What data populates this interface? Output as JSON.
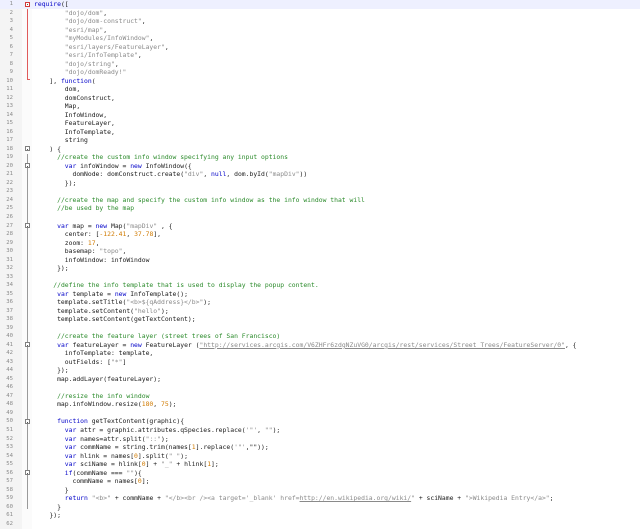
{
  "editor": {
    "language": "javascript",
    "current_line": 1,
    "lines": [
      {
        "n": "1",
        "fold": "box-red",
        "t": [
          [
            "k",
            "require"
          ],
          [
            "p",
            "(["
          ]
        ]
      },
      {
        "n": "2",
        "t": [
          [
            "p",
            "        "
          ],
          [
            "s",
            "\"dojo/dom\""
          ],
          [
            "p",
            ","
          ]
        ]
      },
      {
        "n": "3",
        "t": [
          [
            "p",
            "        "
          ],
          [
            "s",
            "\"dojo/dom-construct\""
          ],
          [
            "p",
            ","
          ]
        ]
      },
      {
        "n": "4",
        "t": [
          [
            "p",
            "        "
          ],
          [
            "s",
            "\"esri/map\""
          ],
          [
            "p",
            ","
          ]
        ]
      },
      {
        "n": "5",
        "t": [
          [
            "p",
            "        "
          ],
          [
            "s",
            "\"myModules/InfoWindow\""
          ],
          [
            "p",
            ","
          ]
        ]
      },
      {
        "n": "6",
        "t": [
          [
            "p",
            "        "
          ],
          [
            "s",
            "\"esri/layers/FeatureLayer\""
          ],
          [
            "p",
            ","
          ]
        ]
      },
      {
        "n": "7",
        "t": [
          [
            "p",
            "        "
          ],
          [
            "s",
            "\"esri/InfoTemplate\""
          ],
          [
            "p",
            ","
          ]
        ]
      },
      {
        "n": "8",
        "t": [
          [
            "p",
            "        "
          ],
          [
            "s",
            "\"dojo/string\""
          ],
          [
            "p",
            ","
          ]
        ]
      },
      {
        "n": "9",
        "t": [
          [
            "p",
            "        "
          ],
          [
            "s",
            "\"dojo/domReady!\""
          ]
        ]
      },
      {
        "n": "10",
        "fold": "end-red",
        "t": [
          [
            "p",
            "    ], "
          ],
          [
            "k",
            "function"
          ],
          [
            "p",
            "("
          ]
        ]
      },
      {
        "n": "11",
        "t": [
          [
            "p",
            "        dom,"
          ]
        ]
      },
      {
        "n": "12",
        "t": [
          [
            "p",
            "        domConstruct,"
          ]
        ]
      },
      {
        "n": "13",
        "t": [
          [
            "p",
            "        Map,"
          ]
        ]
      },
      {
        "n": "14",
        "t": [
          [
            "p",
            "        InfoWindow,"
          ]
        ]
      },
      {
        "n": "15",
        "t": [
          [
            "p",
            "        FeatureLayer,"
          ]
        ]
      },
      {
        "n": "16",
        "t": [
          [
            "p",
            "        InfoTemplate,"
          ]
        ]
      },
      {
        "n": "17",
        "t": [
          [
            "p",
            "        string"
          ]
        ]
      },
      {
        "n": "18",
        "fold": "box",
        "t": [
          [
            "p",
            "    ) {"
          ]
        ]
      },
      {
        "n": "19",
        "t": [
          [
            "p",
            "      "
          ],
          [
            "c",
            "//create the custom info window specifying any input options"
          ]
        ]
      },
      {
        "n": "20",
        "fold": "box",
        "t": [
          [
            "p",
            "        "
          ],
          [
            "k",
            "var"
          ],
          [
            "p",
            " infoWindow = "
          ],
          [
            "k",
            "new"
          ],
          [
            "p",
            " InfoWindow({"
          ]
        ]
      },
      {
        "n": "21",
        "t": [
          [
            "p",
            "          domNode: domConstruct.create("
          ],
          [
            "s",
            "\"div\""
          ],
          [
            "p",
            ", "
          ],
          [
            "k",
            "null"
          ],
          [
            "p",
            ", dom.byId("
          ],
          [
            "s",
            "\"mapDiv\""
          ],
          [
            "p",
            "))"
          ]
        ]
      },
      {
        "n": "22",
        "t": [
          [
            "p",
            "        });"
          ]
        ]
      },
      {
        "n": "23",
        "t": [
          [
            "p",
            ""
          ]
        ]
      },
      {
        "n": "24",
        "t": [
          [
            "p",
            "      "
          ],
          [
            "c",
            "//create the map and specify the custom info window as the info window that will"
          ]
        ]
      },
      {
        "n": "25",
        "t": [
          [
            "p",
            "      "
          ],
          [
            "c",
            "//be used by the map"
          ]
        ]
      },
      {
        "n": "26",
        "t": [
          [
            "p",
            ""
          ]
        ]
      },
      {
        "n": "27",
        "fold": "box",
        "t": [
          [
            "p",
            "      "
          ],
          [
            "k",
            "var"
          ],
          [
            "p",
            " map = "
          ],
          [
            "k",
            "new"
          ],
          [
            "p",
            " Map("
          ],
          [
            "s",
            "\"mapDiv\""
          ],
          [
            "p",
            " , {"
          ]
        ]
      },
      {
        "n": "28",
        "t": [
          [
            "p",
            "        center: ["
          ],
          [
            "n",
            "-122.41"
          ],
          [
            "p",
            ", "
          ],
          [
            "n",
            "37.78"
          ],
          [
            "p",
            "],"
          ]
        ]
      },
      {
        "n": "29",
        "t": [
          [
            "p",
            "        zoom: "
          ],
          [
            "n",
            "17"
          ],
          [
            "p",
            ","
          ]
        ]
      },
      {
        "n": "30",
        "t": [
          [
            "p",
            "        basemap: "
          ],
          [
            "s",
            "\"topo\""
          ],
          [
            "p",
            ","
          ]
        ]
      },
      {
        "n": "31",
        "t": [
          [
            "p",
            "        infoWindow: infoWindow"
          ]
        ]
      },
      {
        "n": "32",
        "t": [
          [
            "p",
            "      });"
          ]
        ]
      },
      {
        "n": "33",
        "t": [
          [
            "p",
            ""
          ]
        ]
      },
      {
        "n": "34",
        "t": [
          [
            "p",
            "     "
          ],
          [
            "c",
            "//define the info template that is used to display the popup content."
          ]
        ]
      },
      {
        "n": "35",
        "t": [
          [
            "p",
            "      "
          ],
          [
            "k",
            "var"
          ],
          [
            "p",
            " template = "
          ],
          [
            "k",
            "new"
          ],
          [
            "p",
            " InfoTemplate();"
          ]
        ]
      },
      {
        "n": "36",
        "t": [
          [
            "p",
            "      template.setTitle("
          ],
          [
            "s",
            "\"<b>${qAddress}</b>\""
          ],
          [
            "p",
            ");"
          ]
        ]
      },
      {
        "n": "37",
        "t": [
          [
            "p",
            "      template.setContent("
          ],
          [
            "s",
            "\"hello\""
          ],
          [
            "p",
            ");"
          ]
        ]
      },
      {
        "n": "38",
        "t": [
          [
            "p",
            "      template.setContent(getTextContent);"
          ]
        ]
      },
      {
        "n": "39",
        "t": [
          [
            "p",
            ""
          ]
        ]
      },
      {
        "n": "40",
        "t": [
          [
            "p",
            "      "
          ],
          [
            "c",
            "//create the feature layer (street trees of San Francisco)"
          ]
        ]
      },
      {
        "n": "41",
        "fold": "box",
        "t": [
          [
            "p",
            "      "
          ],
          [
            "k",
            "var"
          ],
          [
            "p",
            " featureLayer = "
          ],
          [
            "k",
            "new"
          ],
          [
            "p",
            " FeatureLayer ("
          ],
          [
            "u",
            "\"http://services.arcgis.com/V6ZHFr6zdgNZuVG0/arcgis/rest/services/Street_Trees/FeatureServer/0\""
          ],
          [
            "p",
            ", {"
          ]
        ]
      },
      {
        "n": "42",
        "t": [
          [
            "p",
            "        infoTemplate: template,"
          ]
        ]
      },
      {
        "n": "43",
        "t": [
          [
            "p",
            "        outFields: ["
          ],
          [
            "s",
            "\"*\""
          ],
          [
            "p",
            "]"
          ]
        ]
      },
      {
        "n": "44",
        "t": [
          [
            "p",
            "      });"
          ]
        ]
      },
      {
        "n": "45",
        "t": [
          [
            "p",
            "      map.addLayer(featureLayer);"
          ]
        ]
      },
      {
        "n": "46",
        "t": [
          [
            "p",
            ""
          ]
        ]
      },
      {
        "n": "47",
        "t": [
          [
            "p",
            "      "
          ],
          [
            "c",
            "//resize the info window"
          ]
        ]
      },
      {
        "n": "48",
        "t": [
          [
            "p",
            "      map.infoWindow.resize("
          ],
          [
            "n",
            "180"
          ],
          [
            "p",
            ", "
          ],
          [
            "n",
            "75"
          ],
          [
            "p",
            ");"
          ]
        ]
      },
      {
        "n": "49",
        "t": [
          [
            "p",
            ""
          ]
        ]
      },
      {
        "n": "50",
        "fold": "box",
        "t": [
          [
            "p",
            "      "
          ],
          [
            "k",
            "function"
          ],
          [
            "p",
            " getTextContent(graphic){"
          ]
        ]
      },
      {
        "n": "51",
        "t": [
          [
            "p",
            "        "
          ],
          [
            "k",
            "var"
          ],
          [
            "p",
            " attr = graphic.attributes.qSpecies.replace("
          ],
          [
            "s",
            "'\"'"
          ],
          [
            "p",
            ", "
          ],
          [
            "s",
            "\"\""
          ],
          [
            "p",
            ");"
          ]
        ]
      },
      {
        "n": "52",
        "t": [
          [
            "p",
            "        "
          ],
          [
            "k",
            "var"
          ],
          [
            "p",
            " names=attr.split("
          ],
          [
            "s",
            "\"::\""
          ],
          [
            "p",
            ");"
          ]
        ]
      },
      {
        "n": "53",
        "t": [
          [
            "p",
            "        "
          ],
          [
            "k",
            "var"
          ],
          [
            "p",
            " commName = string.trim(names["
          ],
          [
            "n",
            "1"
          ],
          [
            "p",
            "].replace("
          ],
          [
            "s",
            "'\"'"
          ],
          [
            "p",
            ",\"\"));"
          ]
        ]
      },
      {
        "n": "54",
        "t": [
          [
            "p",
            "        "
          ],
          [
            "k",
            "var"
          ],
          [
            "p",
            " hlink = names["
          ],
          [
            "n",
            "0"
          ],
          [
            "p",
            "].split("
          ],
          [
            "s",
            "\" \""
          ],
          [
            "p",
            ");"
          ]
        ]
      },
      {
        "n": "55",
        "t": [
          [
            "p",
            "        "
          ],
          [
            "k",
            "var"
          ],
          [
            "p",
            " sciName = hlink["
          ],
          [
            "n",
            "0"
          ],
          [
            "p",
            "] + "
          ],
          [
            "s",
            "\"_\""
          ],
          [
            "p",
            " + hlink["
          ],
          [
            "n",
            "1"
          ],
          [
            "p",
            "];"
          ]
        ]
      },
      {
        "n": "56",
        "fold": "box",
        "t": [
          [
            "p",
            "        "
          ],
          [
            "k",
            "if"
          ],
          [
            "p",
            "(commName === "
          ],
          [
            "s",
            "\"\""
          ],
          [
            "p",
            "){"
          ]
        ]
      },
      {
        "n": "57",
        "t": [
          [
            "p",
            "          commName = names["
          ],
          [
            "n",
            "0"
          ],
          [
            "p",
            "];"
          ]
        ]
      },
      {
        "n": "58",
        "t": [
          [
            "p",
            "        }"
          ]
        ]
      },
      {
        "n": "59",
        "t": [
          [
            "p",
            "        "
          ],
          [
            "k",
            "return"
          ],
          [
            "p",
            " "
          ],
          [
            "s",
            "\"<b>\""
          ],
          [
            "p",
            " + commName + "
          ],
          [
            "s",
            "\"</b><br /><a target='_blank' href="
          ],
          [
            "u",
            "http://en.wikipedia.org/wiki/"
          ],
          [
            "s",
            "\""
          ],
          [
            "p",
            " + sciName + "
          ],
          [
            "s",
            "\">Wikipedia Entry</a>\""
          ],
          [
            "p",
            ";"
          ]
        ]
      },
      {
        "n": "60",
        "t": [
          [
            "p",
            "      }"
          ]
        ]
      },
      {
        "n": "61",
        "t": [
          [
            "p",
            "    });"
          ]
        ]
      },
      {
        "n": "62",
        "t": [
          [
            "p",
            ""
          ]
        ]
      }
    ]
  }
}
